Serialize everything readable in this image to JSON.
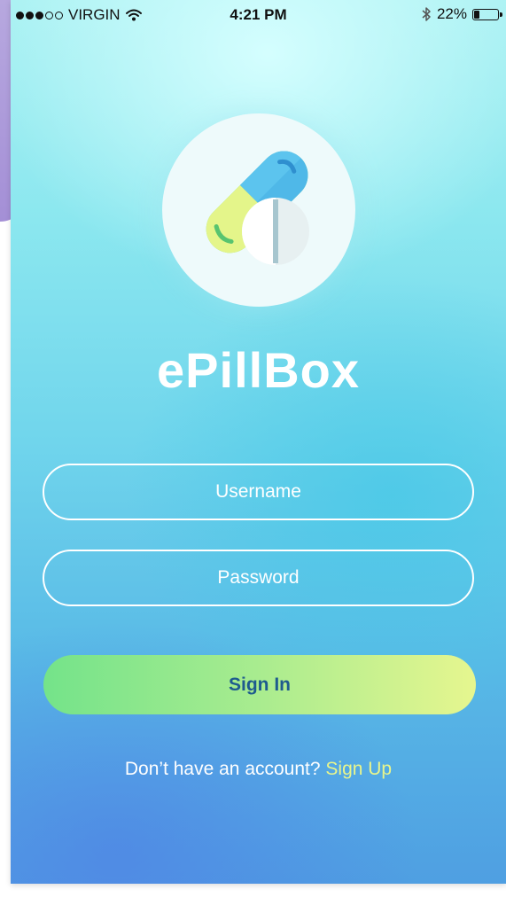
{
  "status_bar": {
    "carrier": "VIRGIN",
    "time": "4:21 PM",
    "battery_percent": "22%",
    "battery_level": 0.22,
    "signal_bars": 3,
    "signal_total": 5,
    "icons": [
      "signal-dots-icon",
      "wifi-icon",
      "bluetooth-icon",
      "battery-icon"
    ]
  },
  "app": {
    "title": "ePillBox",
    "logo_icon": "pill-capsule-icon"
  },
  "login_form": {
    "username_placeholder": "Username",
    "password_placeholder": "Password",
    "sign_in_label": "Sign In"
  },
  "footer": {
    "prompt": "Don’t have an account?",
    "link": "Sign Up"
  },
  "colors": {
    "gradient_top": "#a9f1f2",
    "gradient_bottom": "#4f9fe2",
    "button_start": "#74e38a",
    "button_end": "#e6f68f",
    "button_text": "#1e5b8e",
    "link": "#e8f58c",
    "side_accent": "#a48fd6"
  }
}
